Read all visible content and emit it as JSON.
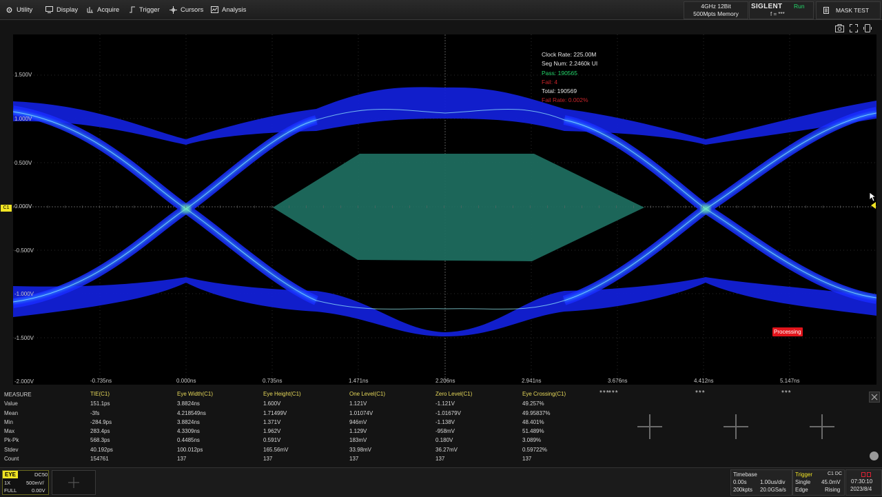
{
  "menu": {
    "utility": "Utility",
    "display": "Display",
    "acquire": "Acquire",
    "trigger": "Trigger",
    "cursors": "Cursors",
    "analysis": "Analysis"
  },
  "header": {
    "spec_line1": "4GHz 12Bit",
    "spec_line2": "500Mpts Memory",
    "brand": "SIGLENT",
    "run_status": "Run",
    "frequency": "f = ***",
    "mask_test": "MASK TEST"
  },
  "waveform": {
    "channel_marker": "C1",
    "y_labels": [
      "1.500V",
      "1.000V",
      "0.500V",
      "0.000V",
      "-0.500V",
      "-1.000V",
      "-1.500V",
      "-2.000V"
    ],
    "x_labels": [
      "-0.735ns",
      "0.000ns",
      "0.735ns",
      "1.471ns",
      "2.206ns",
      "2.941ns",
      "3.676ns",
      "4.412ns",
      "5.147ns"
    ],
    "mask_info": {
      "clock_rate": "Clock Rate: 225.00M",
      "seg_num": "Seg Num: 2.2460k UI",
      "pass": "Pass: 190565",
      "fail": "Fail: 4",
      "total": "Total: 190569",
      "fail_rate": "Fail Rate: 0.002%"
    },
    "processing": "Processing",
    "colors": {
      "eye": "#1a2cff",
      "mask": "#1d6b5e",
      "pass": "#23d66a",
      "fail": "#d8262a"
    }
  },
  "measure": {
    "header_label": "MEASURE",
    "row_labels": [
      "Value",
      "Mean",
      "Min",
      "Max",
      "Pk-Pk",
      "Stdev",
      "Count"
    ],
    "columns": [
      {
        "title": "TIE(C1)",
        "values": [
          "151.1ps",
          "-3fs",
          "-284.9ps",
          "283.4ps",
          "568.3ps",
          "40.192ps",
          "154761"
        ]
      },
      {
        "title": "Eye Width(C1)",
        "values": [
          "3.8824ns",
          "4.218549ns",
          "3.8824ns",
          "4.3309ns",
          "0.4485ns",
          "100.012ps",
          "137"
        ]
      },
      {
        "title": "Eye Height(C1)",
        "values": [
          "1.600V",
          "1.71499V",
          "1.371V",
          "1.962V",
          "0.591V",
          "165.56mV",
          "137"
        ]
      },
      {
        "title": "One Level(C1)",
        "values": [
          "1.121V",
          "1.01074V",
          "946mV",
          "1.129V",
          "183mV",
          "33.98mV",
          "137"
        ]
      },
      {
        "title": "Zero Level(C1)",
        "values": [
          "-1.121V",
          "-1.01679V",
          "-1.138V",
          "-958mV",
          "0.180V",
          "36.27mV",
          "137"
        ]
      },
      {
        "title": "Eye Crossing(C1)",
        "values": [
          "49.257%",
          "49.95837%",
          "48.401%",
          "51.489%",
          "3.089%",
          "0.59722%",
          "137"
        ]
      }
    ],
    "empty_slots": [
      "***",
      "***",
      "***",
      "***"
    ]
  },
  "bottom": {
    "eye": {
      "title": "EYE",
      "coupling": "DC50",
      "probe": "1X",
      "scale": "500mV/",
      "bandwidth": "FULL",
      "offset": "0.00V"
    },
    "timebase": {
      "title": "Timebase",
      "delay": "0.00s",
      "scale": "1.00us/div",
      "points": "200kpts",
      "rate": "20.0GSa/s"
    },
    "trigger": {
      "title": "Trigger",
      "source": "C1 DC",
      "mode": "Single",
      "level": "45.0mV",
      "type": "Edge",
      "slope": "Rising"
    },
    "clock": {
      "time": "07:30:10",
      "date": "2023/8/4"
    }
  }
}
